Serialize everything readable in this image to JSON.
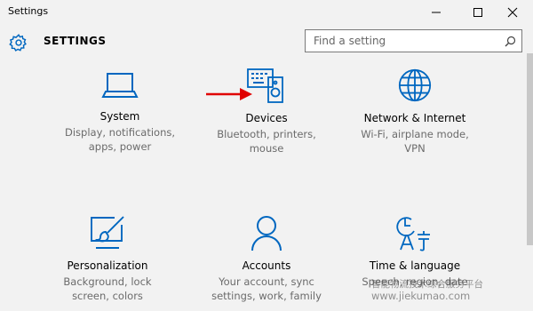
{
  "window": {
    "title": "Settings",
    "controls": [
      "minimize-icon",
      "maximize-icon",
      "close-icon"
    ]
  },
  "header": {
    "title": "SETTINGS",
    "icon": "gear-icon"
  },
  "search": {
    "placeholder": "Find a setting",
    "icon": "search-icon"
  },
  "accent_color": "#0067c0",
  "tiles": [
    {
      "name": "System",
      "icon": "laptop-icon",
      "desc": [
        "Display, notifications,",
        "apps, power"
      ]
    },
    {
      "name": "Devices",
      "icon": "devices-icon",
      "desc": [
        "Bluetooth, printers,",
        "mouse"
      ]
    },
    {
      "name": "Network & Internet",
      "icon": "globe-icon",
      "desc": [
        "Wi-Fi, airplane mode,",
        "VPN"
      ]
    },
    {
      "name": "Personalization",
      "icon": "paint-icon",
      "desc": [
        "Background, lock",
        "screen, colors"
      ]
    },
    {
      "name": "Accounts",
      "icon": "person-icon",
      "desc": [
        "Your account, sync",
        "settings, work, family"
      ]
    },
    {
      "name": "Time & language",
      "icon": "time-language-icon",
      "desc": [
        "Speech, region, date"
      ]
    }
  ],
  "annotation": {
    "arrow_color": "#e00000",
    "target": "Devices"
  },
  "watermark": {
    "line1": "智能物流技术综合服务平台",
    "line2": "www.jiekumao.com"
  }
}
